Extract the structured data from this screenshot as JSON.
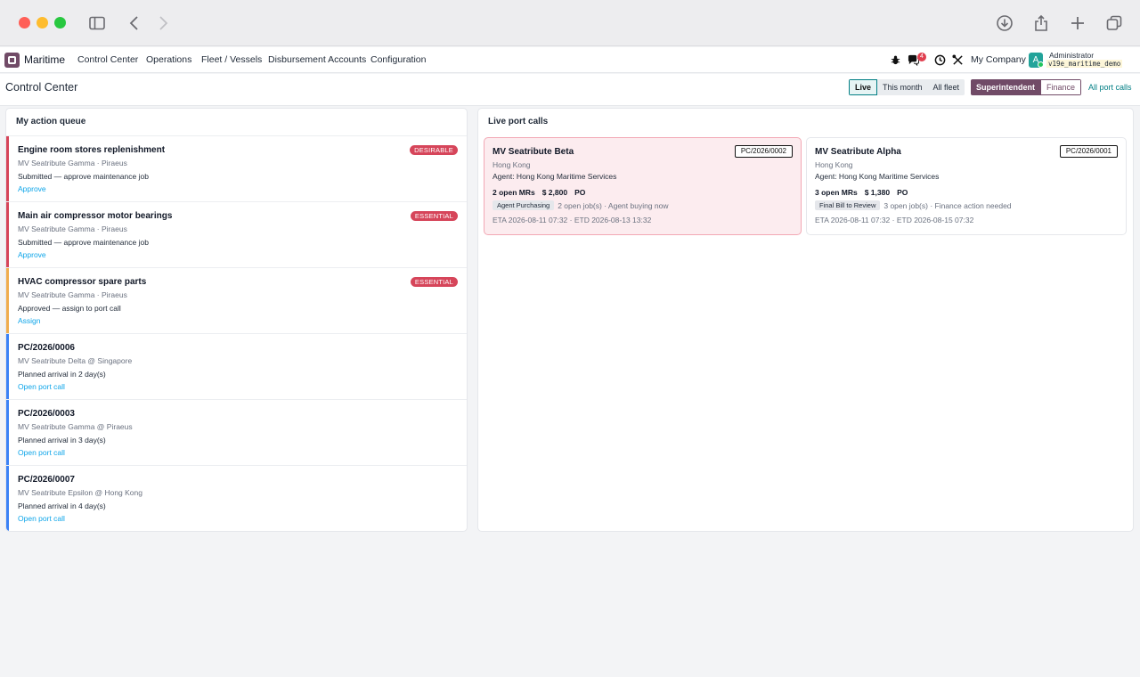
{
  "navbar": {
    "app_name": "Maritime",
    "menu": [
      "Control Center",
      "Operations",
      "Fleet / Vessels",
      "Disbursement Accounts",
      "Configuration"
    ],
    "messages_count": "4",
    "company": "My Company",
    "avatar_letter": "A",
    "user_name": "Administrator",
    "database": "v19e_maritime_demo"
  },
  "control_panel": {
    "breadcrumb": "Control Center",
    "period_filters": [
      "Live",
      "This month",
      "All fleet"
    ],
    "role_filters": [
      "Superintendent",
      "Finance"
    ],
    "all_port_calls": "All port calls"
  },
  "colors": {
    "brand": "#714b67",
    "teal": "#017e84",
    "tag_red": "#d6455a",
    "bar_red": "#d6455a",
    "bar_amber": "#f0ad4e",
    "bar_blue": "#3b82f6"
  },
  "action_queue": {
    "title": "My action queue",
    "items": [
      {
        "title": "Engine room stores replenishment",
        "subtitle": "MV Seatribute Gamma · Piraeus",
        "status": "Submitted — approve maintenance job",
        "action": "Approve",
        "tag": "DESIRABLE"
      },
      {
        "title": "Main air compressor motor bearings",
        "subtitle": "MV Seatribute Gamma · Piraeus",
        "status": "Submitted — approve maintenance job",
        "action": "Approve",
        "tag": "ESSENTIAL"
      },
      {
        "title": "HVAC compressor spare parts",
        "subtitle": "MV Seatribute Gamma · Piraeus",
        "status": "Approved — assign to port call",
        "action": "Assign",
        "tag": "ESSENTIAL"
      },
      {
        "title": "PC/2026/0006",
        "subtitle": "MV Seatribute Delta @ Singapore",
        "status": "Planned arrival in 2 day(s)",
        "action": "Open port call",
        "tag": ""
      },
      {
        "title": "PC/2026/0003",
        "subtitle": "MV Seatribute Gamma @ Piraeus",
        "status": "Planned arrival in 3 day(s)",
        "action": "Open port call",
        "tag": ""
      },
      {
        "title": "PC/2026/0007",
        "subtitle": "MV Seatribute Epsilon @ Hong Kong",
        "status": "Planned arrival in 4 day(s)",
        "action": "Open port call",
        "tag": ""
      }
    ]
  },
  "live_port_calls": {
    "title": "Live port calls",
    "cards": [
      {
        "vessel": "MV Seatribute Beta",
        "ref": "PC/2026/0002",
        "port": "Hong Kong",
        "agent": "Agent: Hong Kong Maritime Services",
        "open_mrs": "2 open MRs",
        "amount": "$ 2,800",
        "po": "PO",
        "chip": "Agent Purchasing",
        "chip_note": "2 open job(s) · Agent buying now",
        "eta": "ETA 2026-08-11 07:32 · ETD 2026-08-13 13:32"
      },
      {
        "vessel": "MV Seatribute Alpha",
        "ref": "PC/2026/0001",
        "port": "Hong Kong",
        "agent": "Agent: Hong Kong Maritime Services",
        "open_mrs": "3 open MRs",
        "amount": "$ 1,380",
        "po": "PO",
        "chip": "Final Bill to Review",
        "chip_note": "3 open job(s) · Finance action needed",
        "eta": "ETA 2026-08-11 07:32 · ETD 2026-08-15 07:32"
      }
    ]
  }
}
